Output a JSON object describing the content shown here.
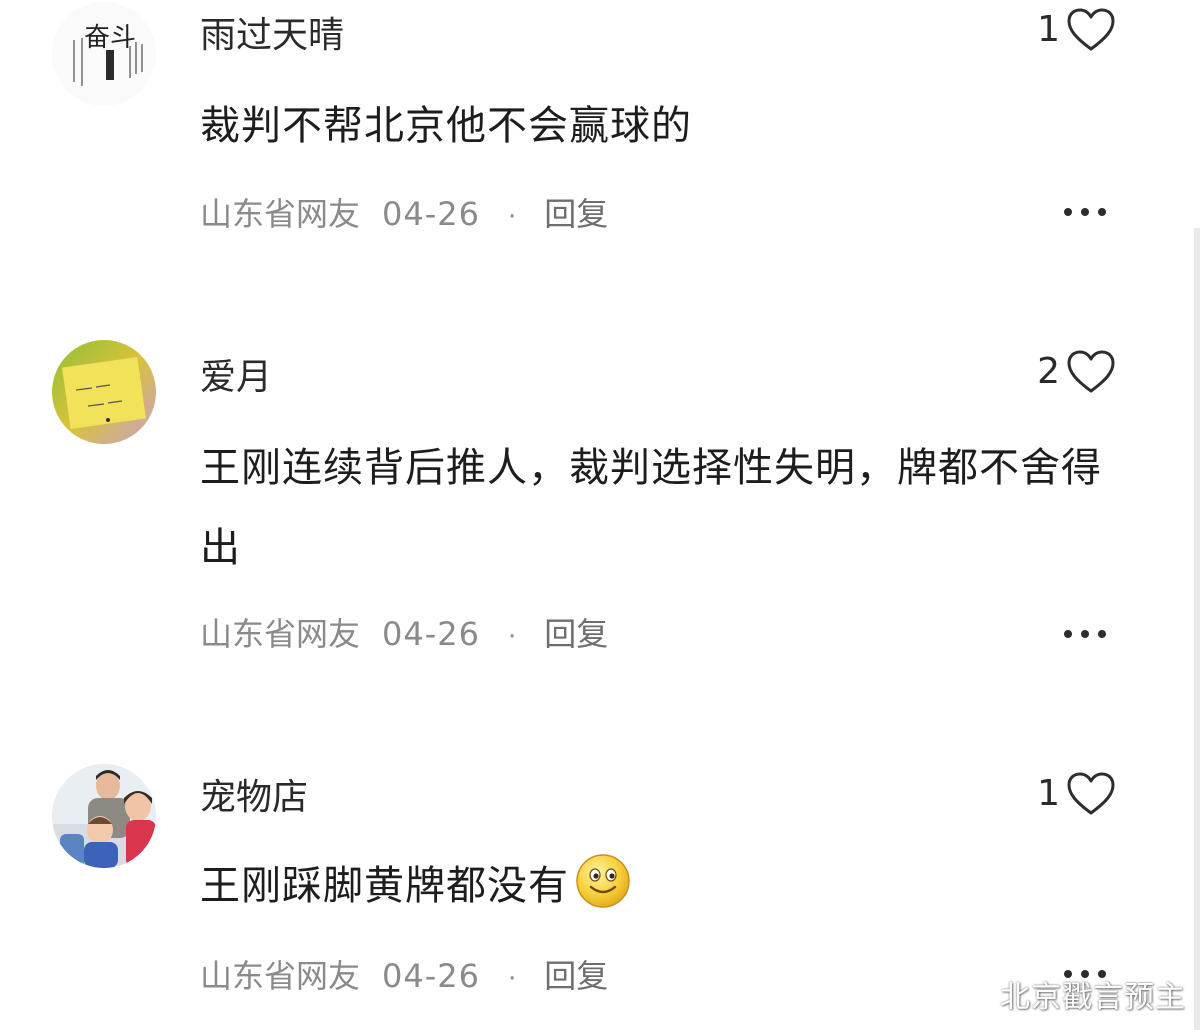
{
  "comments": [
    {
      "username": "雨过天晴",
      "likes": "1",
      "content": "裁判不帮北京他不会赢球的",
      "emoji": "",
      "location": "山东省网友",
      "date": "04-26",
      "separator": "·",
      "reply_label": "回复",
      "avatar_text": "奋斗"
    },
    {
      "username": "爱月",
      "likes": "2",
      "content": "王刚连续背后推人，裁判选择性失明，牌都不舍得出",
      "emoji": "",
      "location": "山东省网友",
      "date": "04-26",
      "separator": "·",
      "reply_label": "回复"
    },
    {
      "username": "宠物店",
      "likes": "1",
      "content": "王刚踩脚黄牌都没有",
      "emoji": "smiling-face-icon",
      "location": "山东省网友",
      "date": "04-26",
      "separator": "·",
      "reply_label": "回复"
    }
  ],
  "icons": {
    "like": "heart-outline-icon",
    "more": "more-dots-icon"
  },
  "watermark": "北京戳言预主",
  "colors": {
    "text": "#1d1d1d",
    "meta": "#8a8a8a",
    "icon": "#2d2d2d"
  }
}
